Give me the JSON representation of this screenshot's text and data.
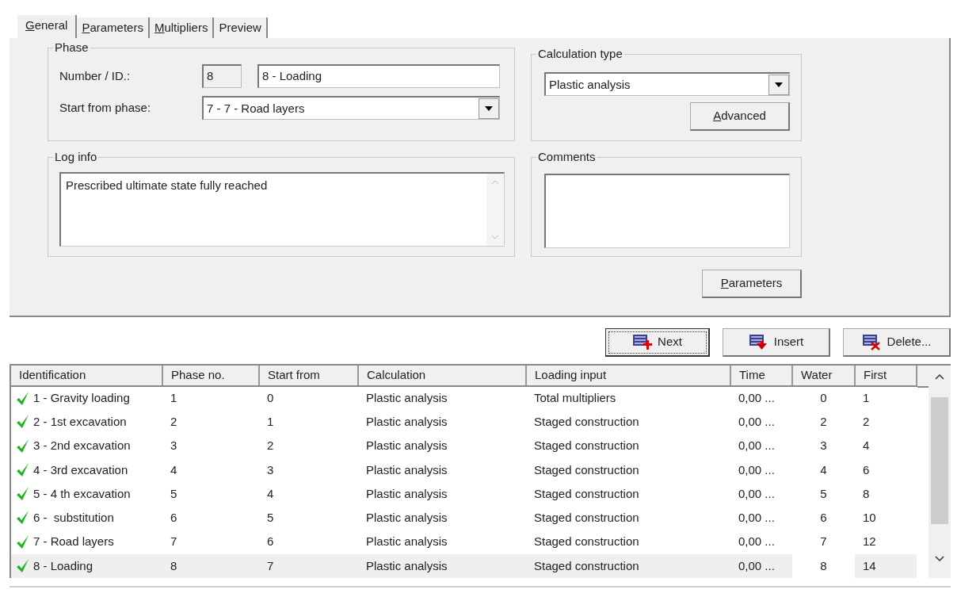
{
  "tabs": [
    {
      "label": "General",
      "mnemonic": true,
      "selected": true
    },
    {
      "label": "Parameters",
      "mnemonic": true,
      "selected": false
    },
    {
      "label": "Multipliers",
      "mnemonic": true,
      "selected": false
    },
    {
      "label": "Preview",
      "mnemonic": false,
      "selected": false
    }
  ],
  "phase": {
    "legend": "Phase",
    "number_label": "Number / ID.:",
    "number": "8",
    "id": "8 - Loading",
    "start_label": "Start from phase:",
    "start_from": "7 - 7 - Road layers"
  },
  "calculation_type": {
    "legend": "Calculation type",
    "value": "Plastic analysis",
    "advanced_button": {
      "label": "Advanced",
      "mnemonic": true
    }
  },
  "log_info": {
    "legend": "Log info",
    "text": "Prescribed ultimate state fully reached"
  },
  "comments": {
    "legend": "Comments"
  },
  "parameters_button": {
    "label": "Parameters",
    "mnemonic": true
  },
  "actions": [
    {
      "label": "Next",
      "kind": "next",
      "focused": true
    },
    {
      "label": "Insert",
      "kind": "insert",
      "focused": false
    },
    {
      "label": "Delete...",
      "kind": "delete",
      "focused": false
    }
  ],
  "table": {
    "columns": [
      "Identification",
      "Phase no.",
      "Start from",
      "Calculation",
      "Loading input",
      "Time",
      "Water",
      "First"
    ],
    "rows": [
      {
        "calculated": true,
        "selected": false,
        "cells": [
          "1 - Gravity loading",
          "1",
          "0",
          "Plastic analysis",
          "Total multipliers",
          "0,00 ...",
          "0",
          "1"
        ]
      },
      {
        "calculated": true,
        "selected": false,
        "cells": [
          "2 - 1st excavation",
          "2",
          "1",
          "Plastic analysis",
          "Staged construction",
          "0,00 ...",
          "2",
          "2"
        ]
      },
      {
        "calculated": true,
        "selected": false,
        "cells": [
          "3 - 2nd excavation",
          "3",
          "2",
          "Plastic analysis",
          "Staged construction",
          "0,00 ...",
          "3",
          "4"
        ]
      },
      {
        "calculated": true,
        "selected": false,
        "cells": [
          "4 - 3rd excavation",
          "4",
          "3",
          "Plastic analysis",
          "Staged construction",
          "0,00 ...",
          "4",
          "6"
        ]
      },
      {
        "calculated": true,
        "selected": false,
        "cells": [
          "5 - 4 th excavation",
          "5",
          "4",
          "Plastic analysis",
          "Staged construction",
          "0,00 ...",
          "5",
          "8"
        ]
      },
      {
        "calculated": true,
        "selected": false,
        "cells": [
          "6 -  substitution",
          "6",
          "5",
          "Plastic analysis",
          "Staged construction",
          "0,00 ...",
          "6",
          "10"
        ]
      },
      {
        "calculated": true,
        "selected": false,
        "cells": [
          "7 - Road layers",
          "7",
          "6",
          "Plastic analysis",
          "Staged construction",
          "0,00 ...",
          "7",
          "12"
        ]
      },
      {
        "calculated": true,
        "selected": true,
        "cells": [
          "8 - Loading",
          "8",
          "7",
          "Plastic analysis",
          "Staged construction",
          "0,00 ...",
          "8",
          "14"
        ]
      }
    ]
  }
}
